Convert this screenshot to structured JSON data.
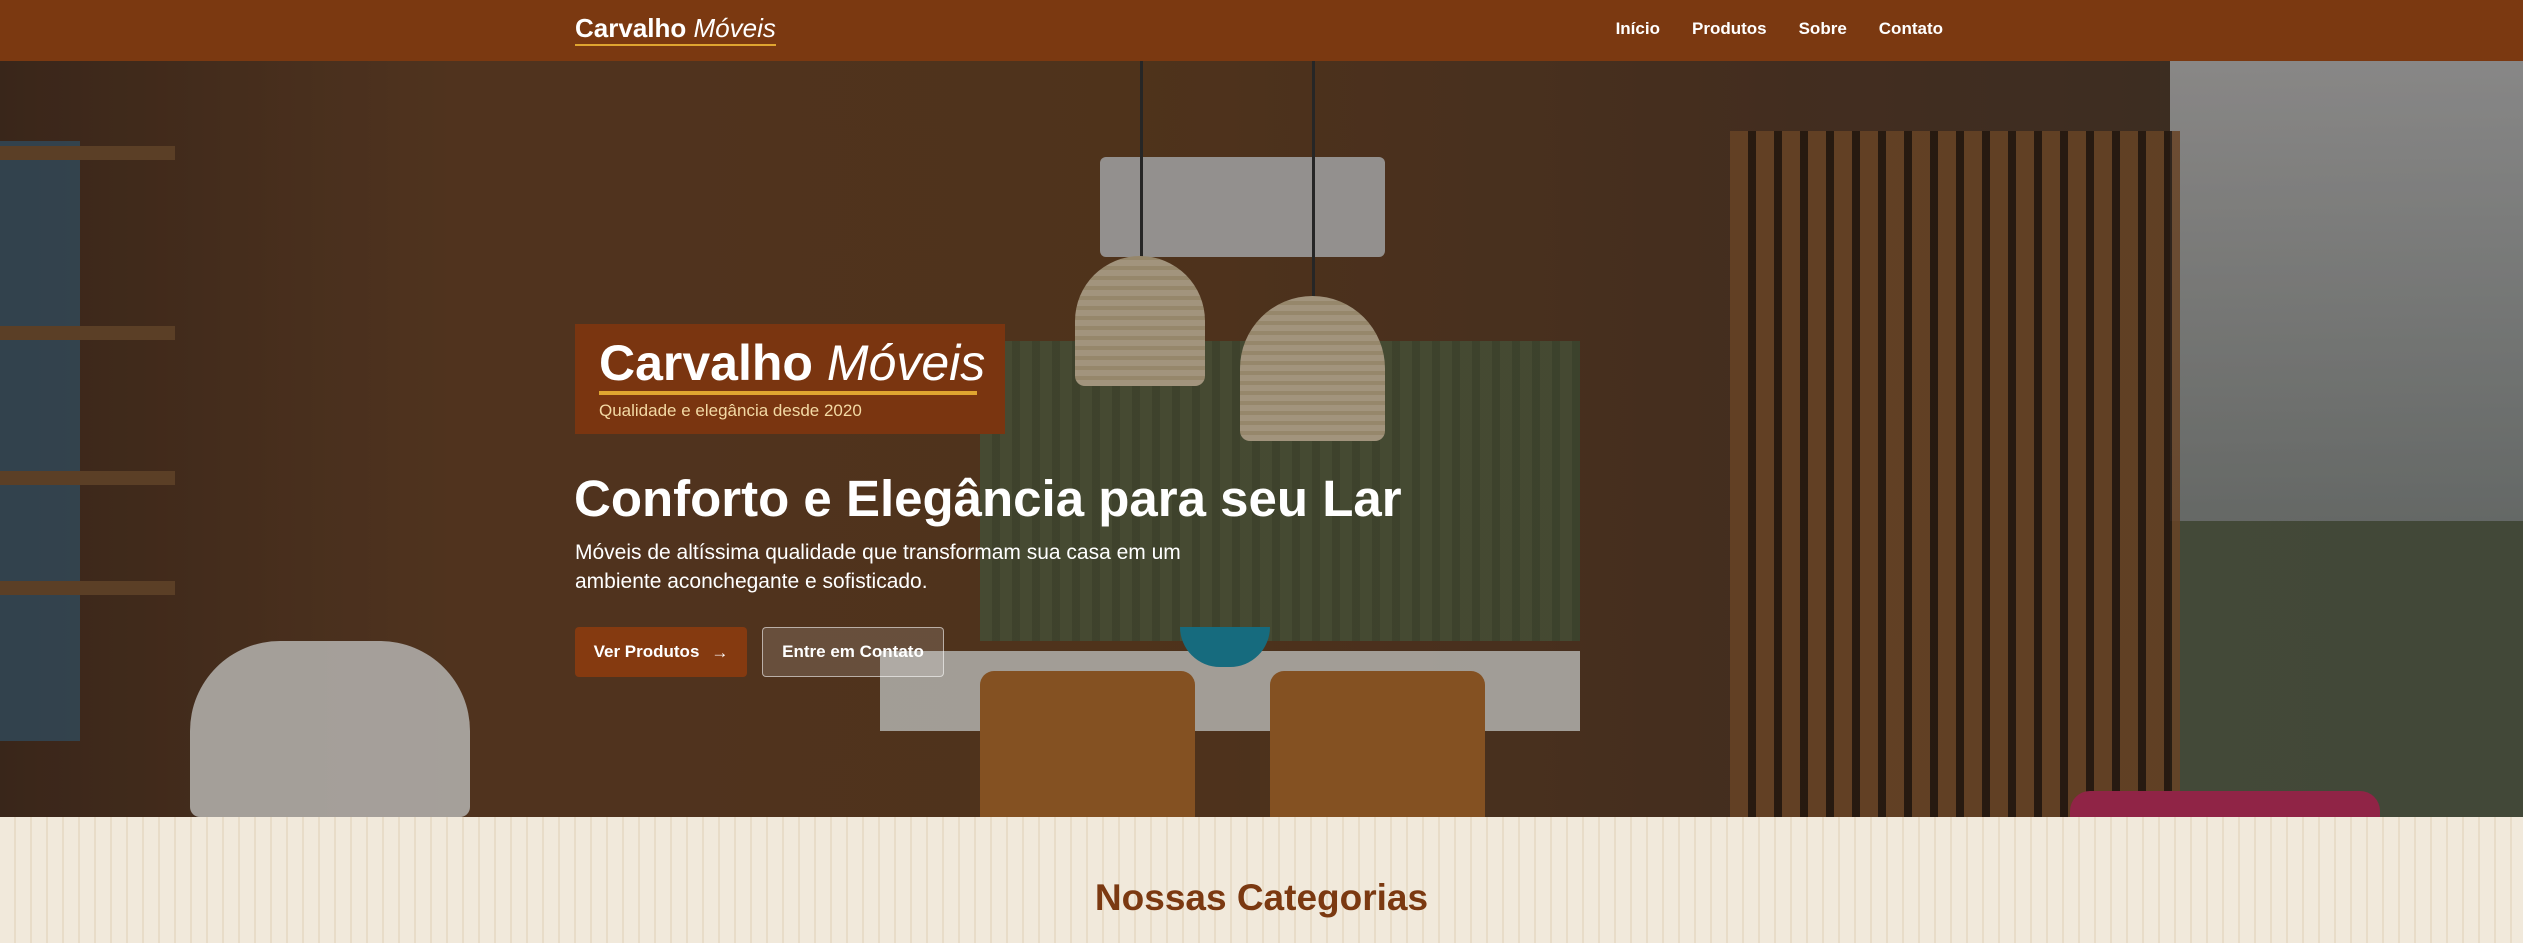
{
  "header": {
    "brand_bold": "Carvalho",
    "brand_italic": "Móveis",
    "nav": [
      {
        "label": "Início"
      },
      {
        "label": "Produtos"
      },
      {
        "label": "Sobre"
      },
      {
        "label": "Contato"
      }
    ]
  },
  "hero": {
    "badge": {
      "title_bold": "Carvalho",
      "title_italic": "Móveis",
      "subtitle": "Qualidade e elegância desde 2020"
    },
    "title": "Conforto e Elegância para seu Lar",
    "description": "Móveis de altíssima qualidade que transformam sua casa em um ambiente aconchegante e sofisticado.",
    "primary_button": "Ver Produtos",
    "secondary_button": "Entre em Contato"
  },
  "categories": {
    "title": "Nossas Categorias"
  },
  "colors": {
    "brand_brown": "#7b3911",
    "accent_gold": "#e0a530",
    "button_brown": "#853a10",
    "section_bg": "#efe6d6"
  },
  "icons": {
    "button_arrow": "arrow-right-icon"
  }
}
